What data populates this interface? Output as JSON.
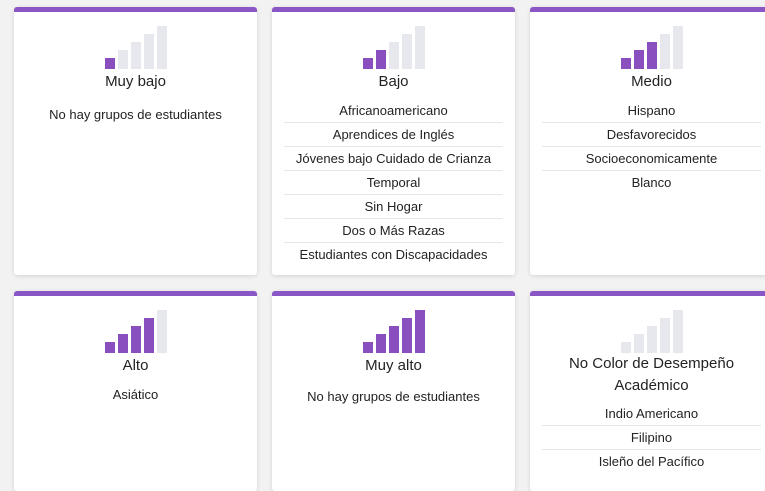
{
  "accent_color": "#8a55c4",
  "cards": [
    {
      "level": "Muy bajo",
      "filled_bars": 1,
      "empty_message": "No hay grupos de estudiantes",
      "groups": []
    },
    {
      "level": "Bajo",
      "filled_bars": 2,
      "groups": [
        "Africanoamericano",
        "Aprendices de Inglés",
        "Jóvenes bajo Cuidado de Crianza",
        "Temporal",
        "Sin Hogar",
        "Dos o Más Razas",
        "Estudiantes con Discapacidades"
      ]
    },
    {
      "level": "Medio",
      "filled_bars": 3,
      "groups": [
        "Hispano",
        "Desfavorecidos",
        "Socioeconomicamente",
        "Blanco"
      ]
    },
    {
      "level": "Alto",
      "filled_bars": 4,
      "groups": [
        "Asiático"
      ]
    },
    {
      "level": "Muy alto",
      "filled_bars": 5,
      "empty_message": "No hay grupos de estudiantes",
      "groups": []
    },
    {
      "level": "No Color de Desempeño Académico",
      "filled_bars": 0,
      "groups": [
        "Indio Americano",
        "Filipino",
        "Isleño del Pacífico"
      ]
    }
  ]
}
